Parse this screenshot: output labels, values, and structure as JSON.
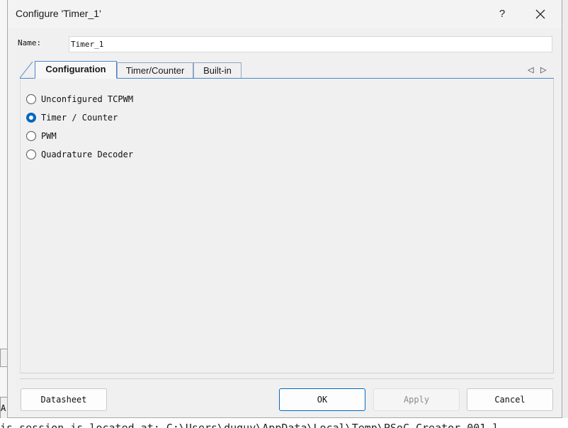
{
  "window": {
    "title": "Configure 'Timer_1'",
    "help_glyph": "?"
  },
  "name_field": {
    "label": "Name:",
    "value": "Timer_1"
  },
  "tabs": [
    {
      "label": "Configuration",
      "active": true
    },
    {
      "label": "Timer/Counter",
      "active": false
    },
    {
      "label": "Built-in",
      "active": false
    }
  ],
  "tab_nav": {
    "prev": "◁",
    "next": "▷"
  },
  "options": [
    {
      "label": "Unconfigured TCPWM",
      "selected": false
    },
    {
      "label": "Timer / Counter",
      "selected": true
    },
    {
      "label": "PWM",
      "selected": false
    },
    {
      "label": "Quadrature Decoder",
      "selected": false
    }
  ],
  "buttons": {
    "datasheet": "Datasheet",
    "ok": "OK",
    "apply": "Apply",
    "cancel": "Cancel"
  },
  "background": {
    "console_text": "is session is located at: C:\\Users\\duguy\\AppData\\Local\\Temp\\PSoC Creator 001.l",
    "left_fragment": "A"
  },
  "colors": {
    "accent": "#0067c0",
    "tab_border": "#4a86c8"
  }
}
